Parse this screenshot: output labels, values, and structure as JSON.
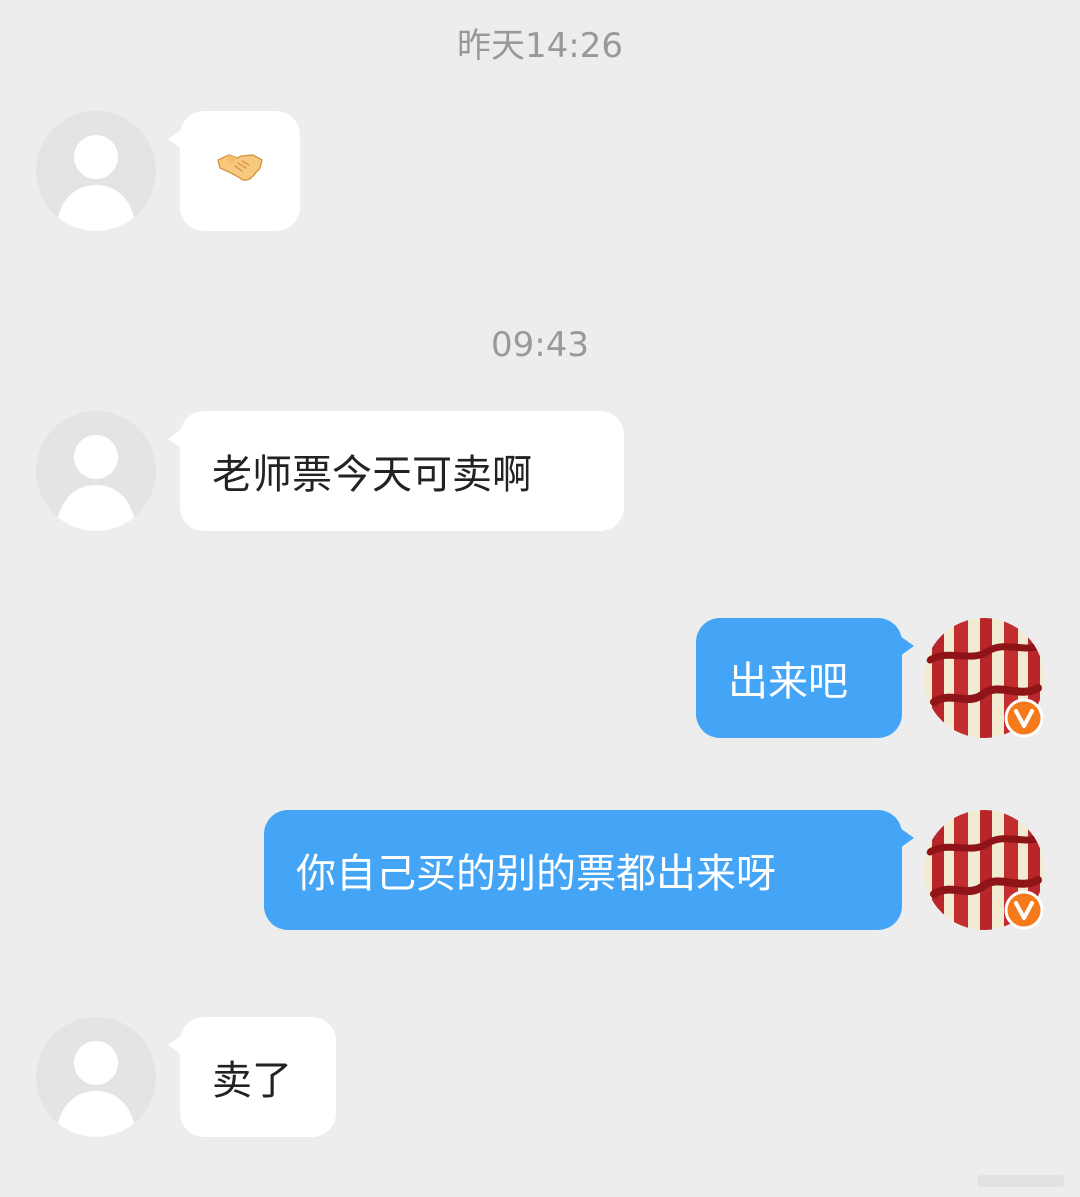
{
  "colors": {
    "background": "#ededed",
    "incoming_bubble": "#ffffff",
    "outgoing_bubble": "#44a4f6",
    "timestamp_text": "#999999",
    "verified_badge": "#f47a1c"
  },
  "timestamps": [
    "昨天14:26",
    "09:43"
  ],
  "messages": [
    {
      "side": "incoming",
      "icon": "handshake-emoji-icon"
    },
    {
      "side": "incoming",
      "text": "老师票今天可卖啊"
    },
    {
      "side": "outgoing",
      "text": "出来吧"
    },
    {
      "side": "outgoing",
      "text": "你自己买的别的票都出来呀"
    },
    {
      "side": "incoming",
      "text": "卖了"
    }
  ],
  "avatars": {
    "incoming": "default-user-avatar-icon",
    "outgoing": {
      "icon": "calligraphy-avatar-icon",
      "badge": "verified-v-badge-icon"
    }
  }
}
